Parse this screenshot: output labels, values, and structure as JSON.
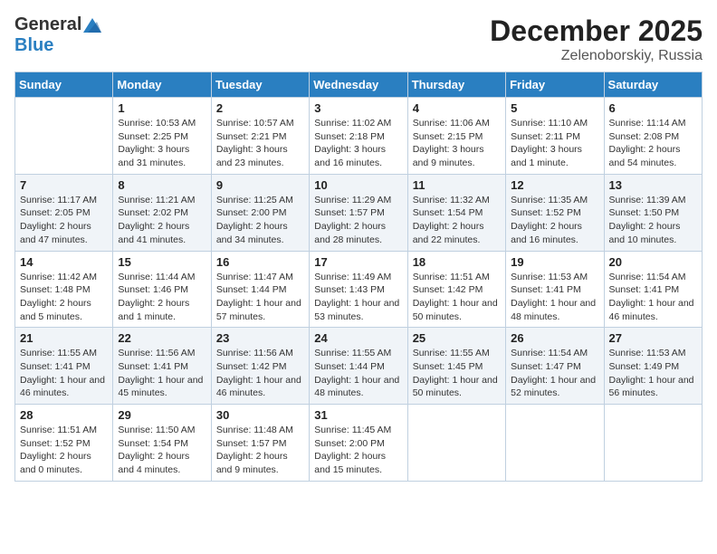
{
  "header": {
    "logo_general": "General",
    "logo_blue": "Blue",
    "month": "December 2025",
    "location": "Zelenoborskiy, Russia"
  },
  "days_of_week": [
    "Sunday",
    "Monday",
    "Tuesday",
    "Wednesday",
    "Thursday",
    "Friday",
    "Saturday"
  ],
  "weeks": [
    {
      "shaded": false,
      "days": [
        {
          "number": "",
          "info": ""
        },
        {
          "number": "1",
          "info": "Sunrise: 10:53 AM\nSunset: 2:25 PM\nDaylight: 3 hours\nand 31 minutes."
        },
        {
          "number": "2",
          "info": "Sunrise: 10:57 AM\nSunset: 2:21 PM\nDaylight: 3 hours\nand 23 minutes."
        },
        {
          "number": "3",
          "info": "Sunrise: 11:02 AM\nSunset: 2:18 PM\nDaylight: 3 hours\nand 16 minutes."
        },
        {
          "number": "4",
          "info": "Sunrise: 11:06 AM\nSunset: 2:15 PM\nDaylight: 3 hours\nand 9 minutes."
        },
        {
          "number": "5",
          "info": "Sunrise: 11:10 AM\nSunset: 2:11 PM\nDaylight: 3 hours\nand 1 minute."
        },
        {
          "number": "6",
          "info": "Sunrise: 11:14 AM\nSunset: 2:08 PM\nDaylight: 2 hours\nand 54 minutes."
        }
      ]
    },
    {
      "shaded": true,
      "days": [
        {
          "number": "7",
          "info": "Sunrise: 11:17 AM\nSunset: 2:05 PM\nDaylight: 2 hours\nand 47 minutes."
        },
        {
          "number": "8",
          "info": "Sunrise: 11:21 AM\nSunset: 2:02 PM\nDaylight: 2 hours\nand 41 minutes."
        },
        {
          "number": "9",
          "info": "Sunrise: 11:25 AM\nSunset: 2:00 PM\nDaylight: 2 hours\nand 34 minutes."
        },
        {
          "number": "10",
          "info": "Sunrise: 11:29 AM\nSunset: 1:57 PM\nDaylight: 2 hours\nand 28 minutes."
        },
        {
          "number": "11",
          "info": "Sunrise: 11:32 AM\nSunset: 1:54 PM\nDaylight: 2 hours\nand 22 minutes."
        },
        {
          "number": "12",
          "info": "Sunrise: 11:35 AM\nSunset: 1:52 PM\nDaylight: 2 hours\nand 16 minutes."
        },
        {
          "number": "13",
          "info": "Sunrise: 11:39 AM\nSunset: 1:50 PM\nDaylight: 2 hours\nand 10 minutes."
        }
      ]
    },
    {
      "shaded": false,
      "days": [
        {
          "number": "14",
          "info": "Sunrise: 11:42 AM\nSunset: 1:48 PM\nDaylight: 2 hours\nand 5 minutes."
        },
        {
          "number": "15",
          "info": "Sunrise: 11:44 AM\nSunset: 1:46 PM\nDaylight: 2 hours\nand 1 minute."
        },
        {
          "number": "16",
          "info": "Sunrise: 11:47 AM\nSunset: 1:44 PM\nDaylight: 1 hour and\n57 minutes."
        },
        {
          "number": "17",
          "info": "Sunrise: 11:49 AM\nSunset: 1:43 PM\nDaylight: 1 hour and\n53 minutes."
        },
        {
          "number": "18",
          "info": "Sunrise: 11:51 AM\nSunset: 1:42 PM\nDaylight: 1 hour and\n50 minutes."
        },
        {
          "number": "19",
          "info": "Sunrise: 11:53 AM\nSunset: 1:41 PM\nDaylight: 1 hour and\n48 minutes."
        },
        {
          "number": "20",
          "info": "Sunrise: 11:54 AM\nSunset: 1:41 PM\nDaylight: 1 hour and\n46 minutes."
        }
      ]
    },
    {
      "shaded": true,
      "days": [
        {
          "number": "21",
          "info": "Sunrise: 11:55 AM\nSunset: 1:41 PM\nDaylight: 1 hour and\n46 minutes."
        },
        {
          "number": "22",
          "info": "Sunrise: 11:56 AM\nSunset: 1:41 PM\nDaylight: 1 hour and\n45 minutes."
        },
        {
          "number": "23",
          "info": "Sunrise: 11:56 AM\nSunset: 1:42 PM\nDaylight: 1 hour and\n46 minutes."
        },
        {
          "number": "24",
          "info": "Sunrise: 11:55 AM\nSunset: 1:44 PM\nDaylight: 1 hour and\n48 minutes."
        },
        {
          "number": "25",
          "info": "Sunrise: 11:55 AM\nSunset: 1:45 PM\nDaylight: 1 hour and\n50 minutes."
        },
        {
          "number": "26",
          "info": "Sunrise: 11:54 AM\nSunset: 1:47 PM\nDaylight: 1 hour and\n52 minutes."
        },
        {
          "number": "27",
          "info": "Sunrise: 11:53 AM\nSunset: 1:49 PM\nDaylight: 1 hour and\n56 minutes."
        }
      ]
    },
    {
      "shaded": false,
      "days": [
        {
          "number": "28",
          "info": "Sunrise: 11:51 AM\nSunset: 1:52 PM\nDaylight: 2 hours\nand 0 minutes."
        },
        {
          "number": "29",
          "info": "Sunrise: 11:50 AM\nSunset: 1:54 PM\nDaylight: 2 hours\nand 4 minutes."
        },
        {
          "number": "30",
          "info": "Sunrise: 11:48 AM\nSunset: 1:57 PM\nDaylight: 2 hours\nand 9 minutes."
        },
        {
          "number": "31",
          "info": "Sunrise: 11:45 AM\nSunset: 2:00 PM\nDaylight: 2 hours\nand 15 minutes."
        },
        {
          "number": "",
          "info": ""
        },
        {
          "number": "",
          "info": ""
        },
        {
          "number": "",
          "info": ""
        }
      ]
    }
  ]
}
